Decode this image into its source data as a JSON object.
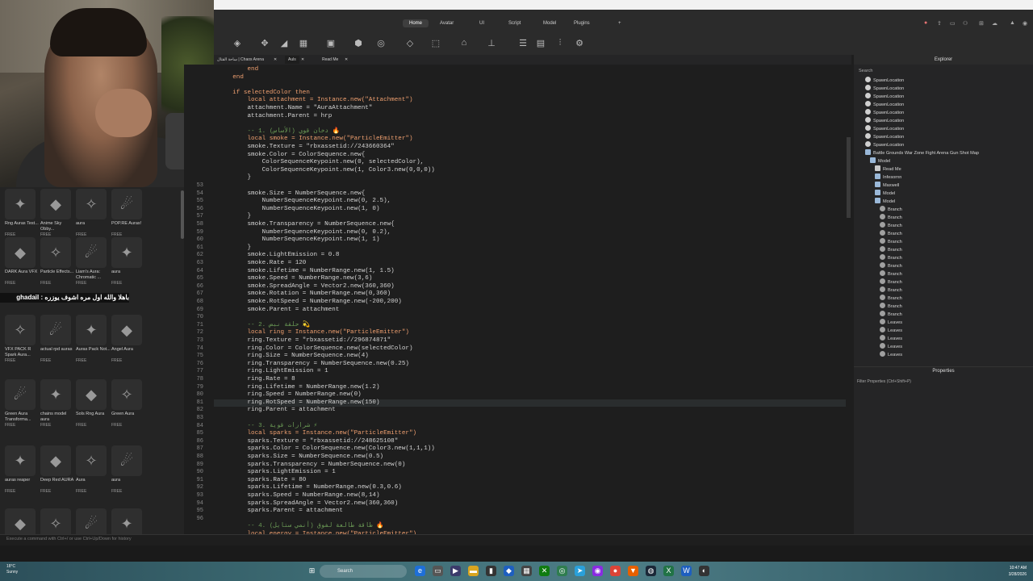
{
  "chat_overlay": "باهلا والله اول مره اشوف يوزره : ghadail",
  "asset_rows": [
    [
      {
        "name": "Rng Auras Test...",
        "price": "FREE"
      },
      {
        "name": "Anime Sky Obby...",
        "price": "FREE"
      },
      {
        "name": "aura",
        "price": "FREE"
      },
      {
        "name": "POP.RE Auras!",
        "price": "FREE"
      }
    ],
    [
      {
        "name": "DARK Aura VFX",
        "price": "FREE"
      },
      {
        "name": "Particle Effects...",
        "price": "FREE"
      },
      {
        "name": "Liam's Aura: Chromatic ...",
        "price": "FREE"
      },
      {
        "name": "aura",
        "price": "FREE"
      }
    ],
    [
      {
        "name": "VFX PACK R Spark Aura...",
        "price": "FREE"
      },
      {
        "name": "actual rpd auras",
        "price": "FREE"
      },
      {
        "name": "Auras Pack Not...",
        "price": "FREE"
      },
      {
        "name": "Angel Aura",
        "price": "FREE"
      }
    ],
    [
      {
        "name": "Green Aura Transforma...",
        "price": "FREE"
      },
      {
        "name": "chains model aura",
        "price": "FREE"
      },
      {
        "name": "Sols Rng Aura",
        "price": "FREE"
      },
      {
        "name": "Green Aura",
        "price": "FREE"
      }
    ],
    [
      {
        "name": "auras reaper",
        "price": "FREE"
      },
      {
        "name": "Deep Red AURA",
        "price": "FREE"
      },
      {
        "name": "Aura",
        "price": "FREE"
      },
      {
        "name": "aura",
        "price": "FREE"
      }
    ],
    [
      {
        "name": "",
        "price": ""
      },
      {
        "name": "",
        "price": ""
      },
      {
        "name": "",
        "price": ""
      },
      {
        "name": "",
        "price": ""
      }
    ]
  ],
  "ribbon": {
    "tabs": [
      "Home",
      "Avatar",
      "UI",
      "Script",
      "Model",
      "Plugins"
    ],
    "active_tab": "Home"
  },
  "doc_tabs": [
    {
      "label": "ساحة القتال | Chaos Arena",
      "active": false
    },
    {
      "label": "Auls",
      "active": true
    },
    {
      "label": "Read Me",
      "active": false
    }
  ],
  "code_lines": [
    {
      "n": "",
      "t": "        end"
    },
    {
      "n": "",
      "t": "    end"
    },
    {
      "n": "",
      "t": ""
    },
    {
      "n": "",
      "t": "    if selectedColor then"
    },
    {
      "n": "",
      "t": "        local attachment = Instance.new(\"Attachment\")"
    },
    {
      "n": "",
      "t": "        attachment.Name = \"AuraAttachment\""
    },
    {
      "n": "",
      "t": "        attachment.Parent = hrp"
    },
    {
      "n": "",
      "t": ""
    },
    {
      "n": "",
      "t": "        -- 1. دخان قوي (الأساس) 🔥"
    },
    {
      "n": "",
      "t": "        local smoke = Instance.new(\"ParticleEmitter\")"
    },
    {
      "n": "",
      "t": "        smoke.Texture = \"rbxassetid://243660364\""
    },
    {
      "n": "",
      "t": "        smoke.Color = ColorSequence.new{"
    },
    {
      "n": "",
      "t": "            ColorSequenceKeypoint.new(0, selectedColor),"
    },
    {
      "n": "",
      "t": "            ColorSequenceKeypoint.new(1, Color3.new(0,0,0))"
    },
    {
      "n": "",
      "t": "        }"
    },
    {
      "n": "53",
      "t": ""
    },
    {
      "n": "54",
      "t": "        smoke.Size = NumberSequence.new{"
    },
    {
      "n": "55",
      "t": "            NumberSequenceKeypoint.new(0, 2.5),"
    },
    {
      "n": "56",
      "t": "            NumberSequenceKeypoint.new(1, 0)"
    },
    {
      "n": "57",
      "t": "        }"
    },
    {
      "n": "58",
      "t": "        smoke.Transparency = NumberSequence.new{"
    },
    {
      "n": "59",
      "t": "            NumberSequenceKeypoint.new(0, 0.2),"
    },
    {
      "n": "60",
      "t": "            NumberSequenceKeypoint.new(1, 1)"
    },
    {
      "n": "61",
      "t": "        }"
    },
    {
      "n": "62",
      "t": "        smoke.LightEmission = 0.8"
    },
    {
      "n": "63",
      "t": "        smoke.Rate = 120"
    },
    {
      "n": "64",
      "t": "        smoke.Lifetime = NumberRange.new(1, 1.5)"
    },
    {
      "n": "65",
      "t": "        smoke.Speed = NumberRange.new(3,6)"
    },
    {
      "n": "66",
      "t": "        smoke.SpreadAngle = Vector2.new(360,360)"
    },
    {
      "n": "67",
      "t": "        smoke.Rotation = NumberRange.new(0,360)"
    },
    {
      "n": "68",
      "t": "        smoke.RotSpeed = NumberRange.new(-200,200)"
    },
    {
      "n": "69",
      "t": "        smoke.Parent = attachment"
    },
    {
      "n": "70",
      "t": ""
    },
    {
      "n": "71",
      "t": "        -- 2. حلقة نبض 💫"
    },
    {
      "n": "72",
      "t": "        local ring = Instance.new(\"ParticleEmitter\")"
    },
    {
      "n": "73",
      "t": "        ring.Texture = \"rbxassetid://296874871\""
    },
    {
      "n": "74",
      "t": "        ring.Color = ColorSequence.new(selectedColor)"
    },
    {
      "n": "75",
      "t": "        ring.Size = NumberSequence.new(4)"
    },
    {
      "n": "76",
      "t": "        ring.Transparency = NumberSequence.new(0.25)"
    },
    {
      "n": "77",
      "t": "        ring.LightEmission = 1"
    },
    {
      "n": "78",
      "t": "        ring.Rate = 8"
    },
    {
      "n": "79",
      "t": "        ring.Lifetime = NumberRange.new(1.2)"
    },
    {
      "n": "80",
      "t": "        ring.Speed = NumberRange.new(0)"
    },
    {
      "n": "81",
      "t": "        ring.RotSpeed = NumberRange.new(150)"
    },
    {
      "n": "82",
      "t": "        ring.Parent = attachment"
    },
    {
      "n": "83",
      "t": ""
    },
    {
      "n": "84",
      "t": "        -- 3. شرارات قوية ⚡"
    },
    {
      "n": "85",
      "t": "        local sparks = Instance.new(\"ParticleEmitter\")"
    },
    {
      "n": "86",
      "t": "        sparks.Texture = \"rbxassetid://248625108\""
    },
    {
      "n": "87",
      "t": "        sparks.Color = ColorSequence.new(Color3.new(1,1,1))"
    },
    {
      "n": "88",
      "t": "        sparks.Size = NumberSequence.new(0.5)"
    },
    {
      "n": "89",
      "t": "        sparks.Transparency = NumberSequence.new(0)"
    },
    {
      "n": "90",
      "t": "        sparks.LightEmission = 1"
    },
    {
      "n": "91",
      "t": "        sparks.Rate = 80"
    },
    {
      "n": "92",
      "t": "        sparks.Lifetime = NumberRange.new(0.3,0.6)"
    },
    {
      "n": "93",
      "t": "        sparks.Speed = NumberRange.new(8,14)"
    },
    {
      "n": "94",
      "t": "        sparks.SpreadAngle = Vector2.new(360,360)"
    },
    {
      "n": "95",
      "t": "        sparks.Parent = attachment"
    },
    {
      "n": "96",
      "t": ""
    },
    {
      "n": "",
      "t": "        -- 4. طاقة طالعة لفوق (أنمي ستايل) 🔥"
    },
    {
      "n": "",
      "t": "        local energy = Instance.new(\"ParticleEmitter\")"
    }
  ],
  "explorer": {
    "title": "Explorer",
    "search_placeholder": "Search",
    "items": [
      {
        "label": "SpawnLocation",
        "icon": "spawn",
        "depth": 1
      },
      {
        "label": "SpawnLocation",
        "icon": "spawn",
        "depth": 1
      },
      {
        "label": "SpawnLocation",
        "icon": "spawn",
        "depth": 1
      },
      {
        "label": "SpawnLocation",
        "icon": "spawn",
        "depth": 1
      },
      {
        "label": "SpawnLocation",
        "icon": "spawn",
        "depth": 1
      },
      {
        "label": "SpawnLocation",
        "icon": "spawn",
        "depth": 1
      },
      {
        "label": "SpawnLocation",
        "icon": "spawn",
        "depth": 1
      },
      {
        "label": "SpawnLocation",
        "icon": "spawn",
        "depth": 1
      },
      {
        "label": "SpawnLocation",
        "icon": "spawn",
        "depth": 1
      },
      {
        "label": "Battle Grounds War Zone Fight Arena Gun Shot Map",
        "icon": "model",
        "depth": 1
      },
      {
        "label": "Model",
        "icon": "model",
        "depth": 2
      },
      {
        "label": "Read Me",
        "icon": "script",
        "depth": 3
      },
      {
        "label": "Infesornn",
        "icon": "model",
        "depth": 3
      },
      {
        "label": "Maxwell",
        "icon": "model",
        "depth": 3
      },
      {
        "label": "Model",
        "icon": "model",
        "depth": 3
      },
      {
        "label": "Model",
        "icon": "model",
        "depth": 3
      },
      {
        "label": "Branch",
        "icon": "part",
        "depth": 4
      },
      {
        "label": "Branch",
        "icon": "part",
        "depth": 4
      },
      {
        "label": "Branch",
        "icon": "part",
        "depth": 4
      },
      {
        "label": "Branch",
        "icon": "part",
        "depth": 4
      },
      {
        "label": "Branch",
        "icon": "part",
        "depth": 4
      },
      {
        "label": "Branch",
        "icon": "part",
        "depth": 4
      },
      {
        "label": "Branch",
        "icon": "part",
        "depth": 4
      },
      {
        "label": "Branch",
        "icon": "part",
        "depth": 4
      },
      {
        "label": "Branch",
        "icon": "part",
        "depth": 4
      },
      {
        "label": "Branch",
        "icon": "part",
        "depth": 4
      },
      {
        "label": "Branch",
        "icon": "part",
        "depth": 4
      },
      {
        "label": "Branch",
        "icon": "part",
        "depth": 4
      },
      {
        "label": "Branch",
        "icon": "part",
        "depth": 4
      },
      {
        "label": "Branch",
        "icon": "part",
        "depth": 4
      },
      {
        "label": "Leaves",
        "icon": "part",
        "depth": 4
      },
      {
        "label": "Leaves",
        "icon": "part",
        "depth": 4
      },
      {
        "label": "Leaves",
        "icon": "part",
        "depth": 4
      },
      {
        "label": "Leaves",
        "icon": "part",
        "depth": 4
      },
      {
        "label": "Leaves",
        "icon": "part",
        "depth": 4
      }
    ]
  },
  "properties": {
    "title": "Properties",
    "filter_placeholder": "Filter Properties (Ctrl+Shift+P)"
  },
  "command_bar": {
    "placeholder": "Execute a command with Ctrl+/ or use Ctrl+Up/Down for history"
  },
  "taskbar": {
    "weather_temp": "18°C",
    "weather_desc": "Sunny",
    "search_label": "Search",
    "time": "10:47 AM",
    "date": "3/28/2026"
  }
}
